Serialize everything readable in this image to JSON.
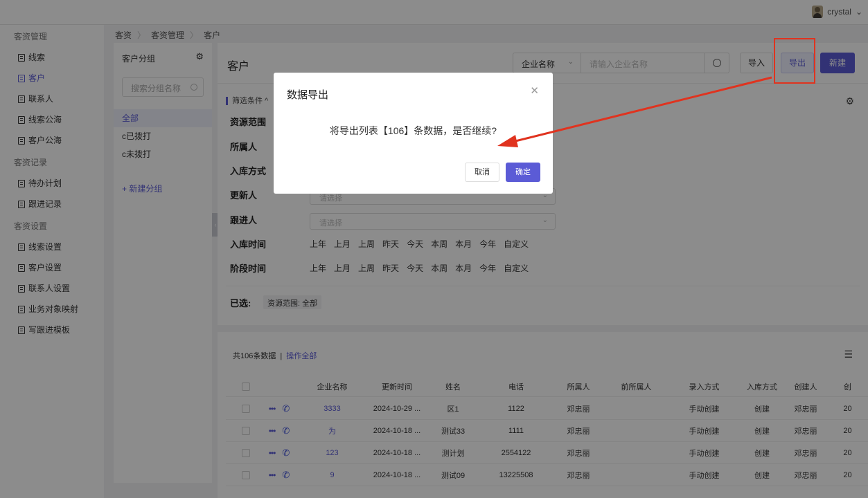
{
  "user": {
    "name": "crystal"
  },
  "sidebar": {
    "sections": [
      {
        "title": "客资管理",
        "items": [
          "线索",
          "客户",
          "联系人",
          "线索公海",
          "客户公海"
        ]
      },
      {
        "title": "客资记录",
        "items": [
          "待办计划",
          "跟进记录"
        ]
      },
      {
        "title": "客资设置",
        "items": [
          "线索设置",
          "客户设置",
          "联系人设置",
          "业务对象映射",
          "写跟进模板"
        ]
      }
    ],
    "active": "客户"
  },
  "breadcrumb": [
    "客资",
    "客资管理",
    "客户"
  ],
  "groups": {
    "title": "客户分组",
    "search_placeholder": "搜索分组名称",
    "items": [
      "全部",
      "c已拨打",
      "c未拨打"
    ],
    "new_label": "+ 新建分组"
  },
  "main": {
    "title": "客户",
    "search_field": "企业名称",
    "search_placeholder": "请输入企业名称",
    "import_label": "导入",
    "export_label": "导出",
    "new_label": "新建"
  },
  "filters": {
    "header": "筛选条件 ^",
    "rows": [
      {
        "label": "资源范围"
      },
      {
        "label": "所属人"
      },
      {
        "label": "入库方式"
      },
      {
        "label": "更新人",
        "placeholder": "请选择"
      },
      {
        "label": "跟进人",
        "placeholder": "请选择"
      },
      {
        "label": "入库时间",
        "options": [
          "上年",
          "上月",
          "上周",
          "昨天",
          "今天",
          "本周",
          "本月",
          "今年",
          "自定义"
        ]
      },
      {
        "label": "阶段时间",
        "options": [
          "上年",
          "上月",
          "上周",
          "昨天",
          "今天",
          "本周",
          "本月",
          "今年",
          "自定义"
        ]
      }
    ],
    "selected_label": "已选:",
    "selected_tag": "资源范围: 全部"
  },
  "list": {
    "count_text": "共106条数据",
    "divider": "|",
    "op_all": "操作全部",
    "columns": [
      "企业名称",
      "更新时间",
      "姓名",
      "电话",
      "所属人",
      "前所属人",
      "录入方式",
      "入库方式",
      "创建人",
      "创"
    ],
    "rows": [
      {
        "company": "3333",
        "updated": "2024-10-29 ...",
        "name": "区1",
        "phone": "1122",
        "owner": "邓忠丽",
        "prev_owner": "",
        "entry": "手动创建",
        "storage": "创建",
        "creator": "邓忠丽",
        "extra": "20"
      },
      {
        "company": "为",
        "updated": "2024-10-18 ...",
        "name": "测试33",
        "phone": "1111",
        "owner": "邓忠丽",
        "prev_owner": "",
        "entry": "手动创建",
        "storage": "创建",
        "creator": "邓忠丽",
        "extra": "20"
      },
      {
        "company": "123",
        "updated": "2024-10-18 ...",
        "name": "测计划",
        "phone": "2554122",
        "owner": "邓忠丽",
        "prev_owner": "",
        "entry": "手动创建",
        "storage": "创建",
        "creator": "邓忠丽",
        "extra": "20"
      },
      {
        "company": "9",
        "updated": "2024-10-18 ...",
        "name": "测试09",
        "phone": "13225508",
        "owner": "邓忠丽",
        "prev_owner": "",
        "entry": "手动创建",
        "storage": "创建",
        "creator": "邓忠丽",
        "extra": "20"
      }
    ]
  },
  "modal": {
    "title": "数据导出",
    "message": "将导出列表【106】条数据，是否继续?",
    "cancel_label": "取消",
    "ok_label": "确定"
  },
  "colors": {
    "accent": "#5b5bd6",
    "annotation": "#e0331f"
  }
}
